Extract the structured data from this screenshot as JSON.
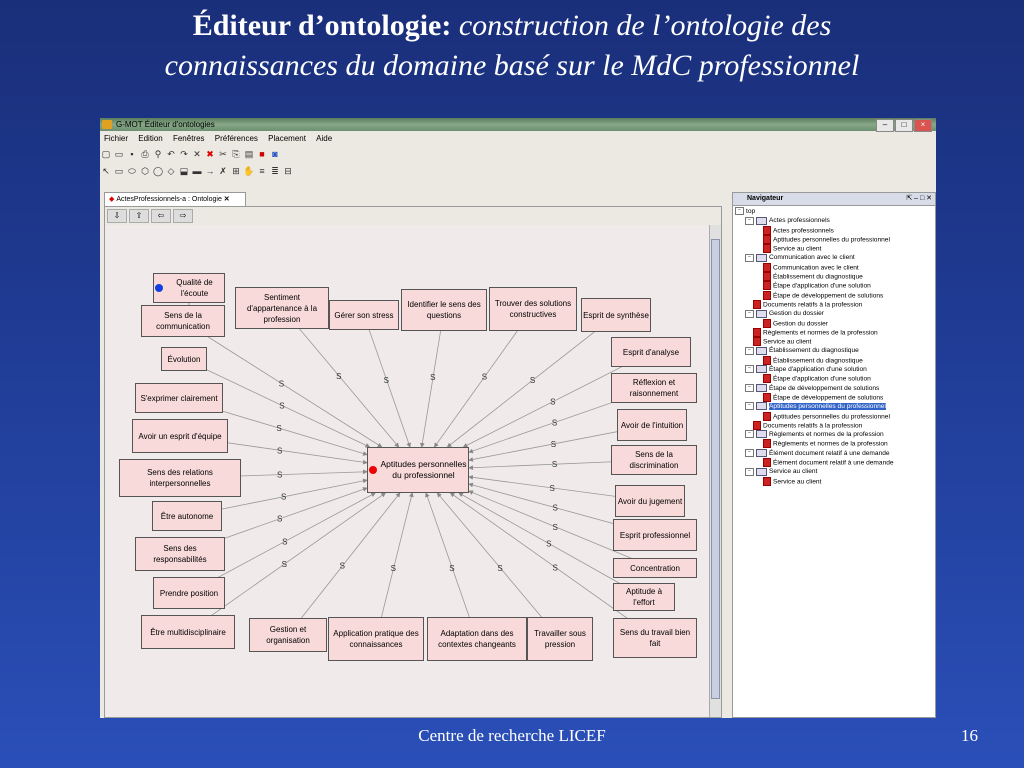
{
  "slide": {
    "title_bold": "Éditeur d’ontologie:",
    "title_italic_1": "construction de  l’ontologie  des",
    "title_italic_2": "connaissances du domaine  basé sur le MdC professionnel",
    "footer_center": "Centre de recherche LICEF",
    "page_number": "16"
  },
  "window": {
    "title": "G-MOT Éditeur d'ontologies",
    "menu": [
      "Fichier",
      "Edition",
      "Fenêtres",
      "Préférences",
      "Placement",
      "Aide"
    ],
    "editor_tab": "ActesProfessionnels-a : Ontologie",
    "navigator_title": "Navigateur"
  },
  "graph": {
    "link_label": "S",
    "center": "Aptitudes personnelles du professionnel",
    "top": "Qualité de l'écoute",
    "nodes": [
      "Sens de la communication",
      "Évolution",
      "S'exprimer clairement",
      "Avoir un esprit d'équipe",
      "Sens des relations interpersonnelles",
      "Être autonome",
      "Sens des responsabilités",
      "Prendre position",
      "Être multidisciplinaire",
      "Gestion et organisation",
      "Application pratique des connaissances",
      "Adaptation dans des contextes changeants",
      "Travailler sous pression",
      "Sens du travail bien fait",
      "Aptitude à l'effort",
      "Concentration",
      "Esprit professionnel",
      "Avoir du jugement",
      "Sens de la discrimination",
      "Avoir de l'intuition",
      "Réflexion et raisonnement",
      "Esprit d'analyse",
      "Esprit de synthèse",
      "Trouver des solutions constructives",
      "Identifier le sens des questions",
      "Gérer son stress",
      "Sentiment d'appartenance à la profession"
    ]
  },
  "tree": [
    {
      "level": 0,
      "type": "box",
      "label": "top"
    },
    {
      "level": 1,
      "type": "fold",
      "label": "Actes professionnels"
    },
    {
      "level": 2,
      "type": "pg",
      "label": "Actes professionnels"
    },
    {
      "level": 2,
      "type": "pg",
      "label": "Aptitudes personnelles du professionnel"
    },
    {
      "level": 2,
      "type": "pg",
      "label": "Service au client"
    },
    {
      "level": 1,
      "type": "fold",
      "label": "Communication avec le client"
    },
    {
      "level": 2,
      "type": "pg",
      "label": "Communication avec le client"
    },
    {
      "level": 2,
      "type": "pg",
      "label": "Établissement du diagnostique"
    },
    {
      "level": 2,
      "type": "pg",
      "label": "Étape d'application d'une solution"
    },
    {
      "level": 2,
      "type": "pg",
      "label": "Étape de développement de solutions"
    },
    {
      "level": 1,
      "type": "pg",
      "label": "Documents relatifs à la profession"
    },
    {
      "level": 1,
      "type": "fold",
      "label": "Gestion du dossier"
    },
    {
      "level": 2,
      "type": "pg",
      "label": "Gestion du dossier"
    },
    {
      "level": 1,
      "type": "pg",
      "label": "Règlements et normes de la profession"
    },
    {
      "level": 1,
      "type": "pg",
      "label": "Service au client"
    },
    {
      "level": 1,
      "type": "fold",
      "label": "Établissement du diagnostique"
    },
    {
      "level": 2,
      "type": "pg",
      "label": "Établissement du diagnostique"
    },
    {
      "level": 1,
      "type": "fold",
      "label": "Étape d'application d'une solution"
    },
    {
      "level": 2,
      "type": "pg",
      "label": "Étape d'application d'une solution"
    },
    {
      "level": 1,
      "type": "fold",
      "label": "Étape de développement de solutions"
    },
    {
      "level": 2,
      "type": "pg",
      "label": "Étape de développement de solutions"
    },
    {
      "level": 1,
      "type": "fold",
      "label": "Aptitudes personnelles du professionnel",
      "selected": true
    },
    {
      "level": 2,
      "type": "pg",
      "label": "Aptitudes personnelles du professionnel"
    },
    {
      "level": 1,
      "type": "pg",
      "label": "Documents relatifs à la profession"
    },
    {
      "level": 1,
      "type": "fold",
      "label": "Règlements et normes de la profession"
    },
    {
      "level": 2,
      "type": "pg",
      "label": "Règlements et normes de la profession"
    },
    {
      "level": 1,
      "type": "fold",
      "label": "Élément document relatif à une demande"
    },
    {
      "level": 2,
      "type": "pg",
      "label": "Élément document relatif à une demande"
    },
    {
      "level": 1,
      "type": "fold",
      "label": "Service au client"
    },
    {
      "level": 2,
      "type": "pg",
      "label": "Service au client"
    }
  ]
}
